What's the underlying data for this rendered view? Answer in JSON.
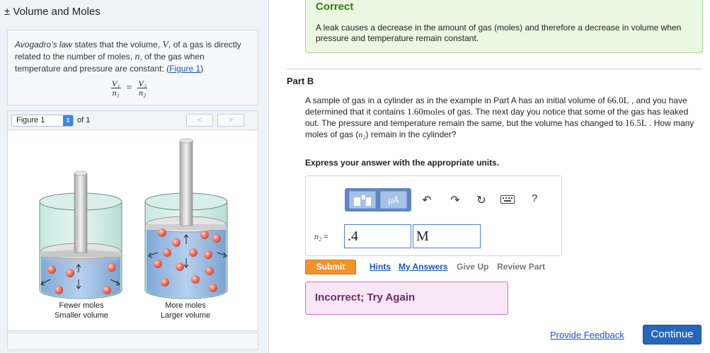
{
  "left": {
    "title": "± Volume and Moles",
    "intro": {
      "p1": "Avogadro’s law",
      "p2": " states that the volume, ",
      "var_v": "V",
      "p3": ", of a gas is directly related to the number of moles, ",
      "var_n": "n",
      "p4": ", of the gas when temperature and pressure are constant: (",
      "link": "Figure 1",
      "p5": ")"
    },
    "formula": {
      "v1": "V₁",
      "n1": "n₁",
      "eq": "=",
      "v2": "V₂",
      "n2": "n₂"
    },
    "figure": {
      "select_value": "Figure 1",
      "of_label": "of 1",
      "prev": "<",
      "next": ">",
      "caption_left": [
        "Fewer moles",
        "Smaller volume"
      ],
      "caption_right": [
        "More moles",
        "Larger volume"
      ]
    }
  },
  "right": {
    "correct_title": "Correct",
    "correct_text": "A leak causes a decrease in the amount of gas (moles) and therefore a decrease in volume when pressure and temperature remain constant.",
    "part_label": "Part B",
    "question": {
      "q1": "A sample of gas in a cylinder as in the example in Part A has an initial volume of ",
      "vol1": "66.0L",
      "q2": " , and you have determined that it contains ",
      "moles": "1.60moles",
      "q3": " of gas. The next day you notice that some of the gas has leaked out. The pressure and temperature remain the same, but the volume has changed to ",
      "vol2": "16.5L",
      "q4": " . How many moles of gas (",
      "var": "n₂",
      "q5": ") remain in the cylinder?"
    },
    "express": "Express your answer with the appropriate units.",
    "toolbar": {
      "units_label": "μÅ",
      "help": "?"
    },
    "answer": {
      "var_label": "n₂",
      "eq": "=",
      "value": ".4",
      "unit": "M"
    },
    "submit": "Submit",
    "links": {
      "hints": "Hints",
      "my_answers": "My Answers",
      "give_up": "Give Up",
      "review": "Review Part"
    },
    "incorrect": "Incorrect; Try Again",
    "feedback": "Provide Feedback",
    "continue": "Continue"
  }
}
